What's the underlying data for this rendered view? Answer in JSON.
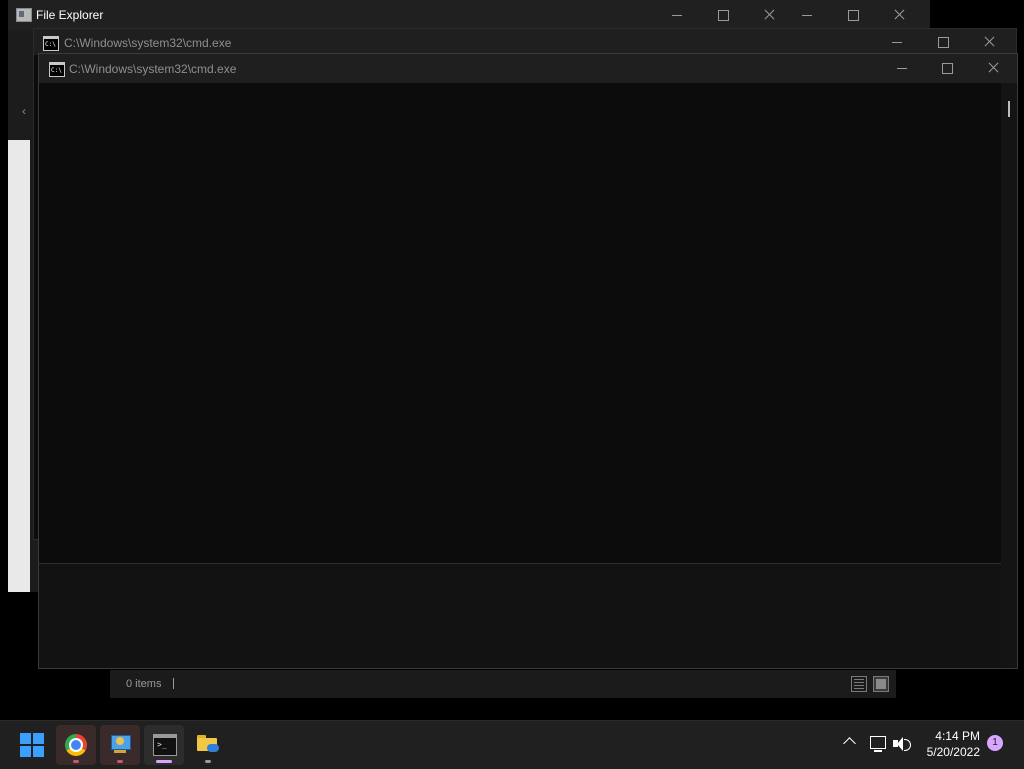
{
  "explorer": {
    "title": "File Explorer",
    "status_items": "0 items"
  },
  "cmd_back": {
    "title": "C:\\Windows\\system32\\cmd.exe"
  },
  "cmd_front": {
    "title": "C:\\Windows\\system32\\cmd.exe"
  },
  "taskbar": {
    "apps": [
      "start-icon",
      "chrome-icon",
      "control-panel-icon",
      "terminal-icon",
      "file-explorer-icon"
    ],
    "time": "4:14 PM",
    "date": "5/20/2022",
    "notification_count": "1"
  },
  "colors": {
    "console_bg": "#0c0c0c",
    "titlebar_bg": "#1f1f1f",
    "taskbar_bg": "#202020",
    "accent": "#3aa0ff",
    "badge": "#d7a7ff"
  }
}
